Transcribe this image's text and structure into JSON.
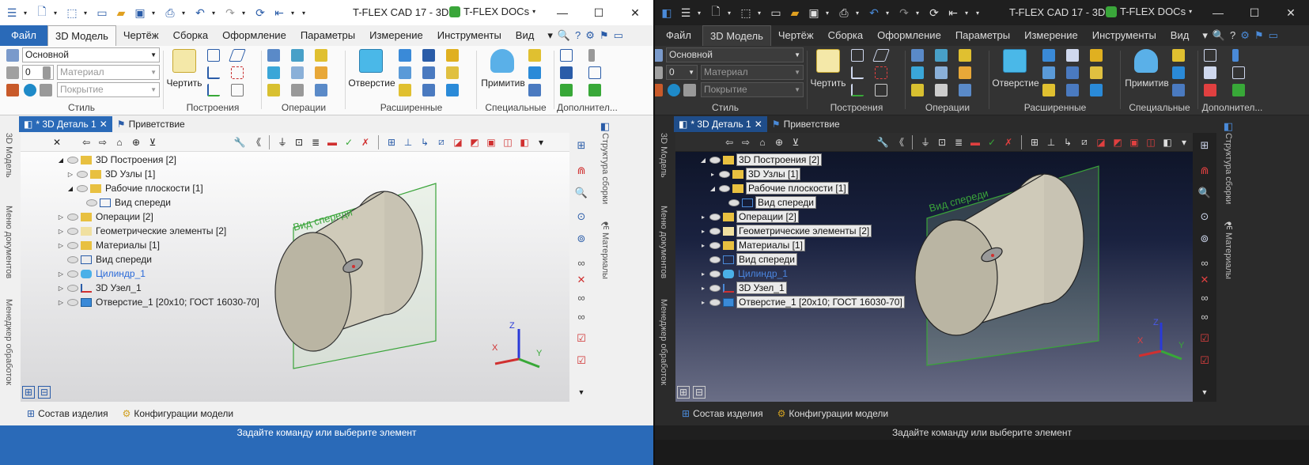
{
  "app": {
    "title": "T-FLEX CAD 17 - 3D ...",
    "docs_label": "T-FLEX DOCs"
  },
  "menu": [
    "Файл",
    "3D Модель",
    "Чертёж",
    "Сборка",
    "Оформление",
    "Параметры",
    "Измерение",
    "Инструменты",
    "Вид"
  ],
  "ribbon": {
    "style_combo": "Основной",
    "layer_combo": "0",
    "material_combo": "Материал",
    "cover_combo": "Покрытие",
    "big_draw": "Чертить",
    "big_hole": "Отверстие",
    "big_prim": "Примитив",
    "groups": [
      "Стиль",
      "Построения",
      "Операции",
      "Расширенные",
      "Специальные",
      "Дополнител..."
    ]
  },
  "doctabs": {
    "active": "* 3D Деталь 1",
    "welcome": "Приветствие"
  },
  "side_left": [
    "3D Модель",
    "Меню документов",
    "Менеджер обработок"
  ],
  "side_right": [
    "Структура сборки",
    "Материалы"
  ],
  "tree": [
    {
      "label": "3D Построения [2]",
      "level": 1,
      "expanded": true
    },
    {
      "label": "3D Узлы [1]",
      "level": 2,
      "expanded": false
    },
    {
      "label": "Рабочие плоскости [1]",
      "level": 2,
      "expanded": true
    },
    {
      "label": "Вид спереди",
      "level": 3
    },
    {
      "label": "Операции [2]",
      "level": 1,
      "expanded": false
    },
    {
      "label": "Геометрические элементы [2]",
      "level": 1,
      "expanded": false
    },
    {
      "label": "Материалы [1]",
      "level": 1,
      "expanded": false
    },
    {
      "label": "Вид спереди",
      "level": 1
    },
    {
      "label": "Цилиндр_1",
      "level": 1,
      "blue": true
    },
    {
      "label": "3D Узел_1",
      "level": 1
    },
    {
      "label": "Отверстие_1 [20х10; ГОСТ 16030-70]",
      "level": 1
    }
  ],
  "plane_label": "Вид спереди",
  "axes": {
    "x": "X",
    "y": "Y",
    "z": "Z"
  },
  "bottom_tabs": [
    "Состав изделия",
    "Конфигурации модели"
  ],
  "status": "Задайте команду или выберите элемент",
  "colors": {
    "accent": "#2a6ab8",
    "dark_bg": "#2b2b2b",
    "plane": "#39a039",
    "body": "#bab5a3"
  }
}
